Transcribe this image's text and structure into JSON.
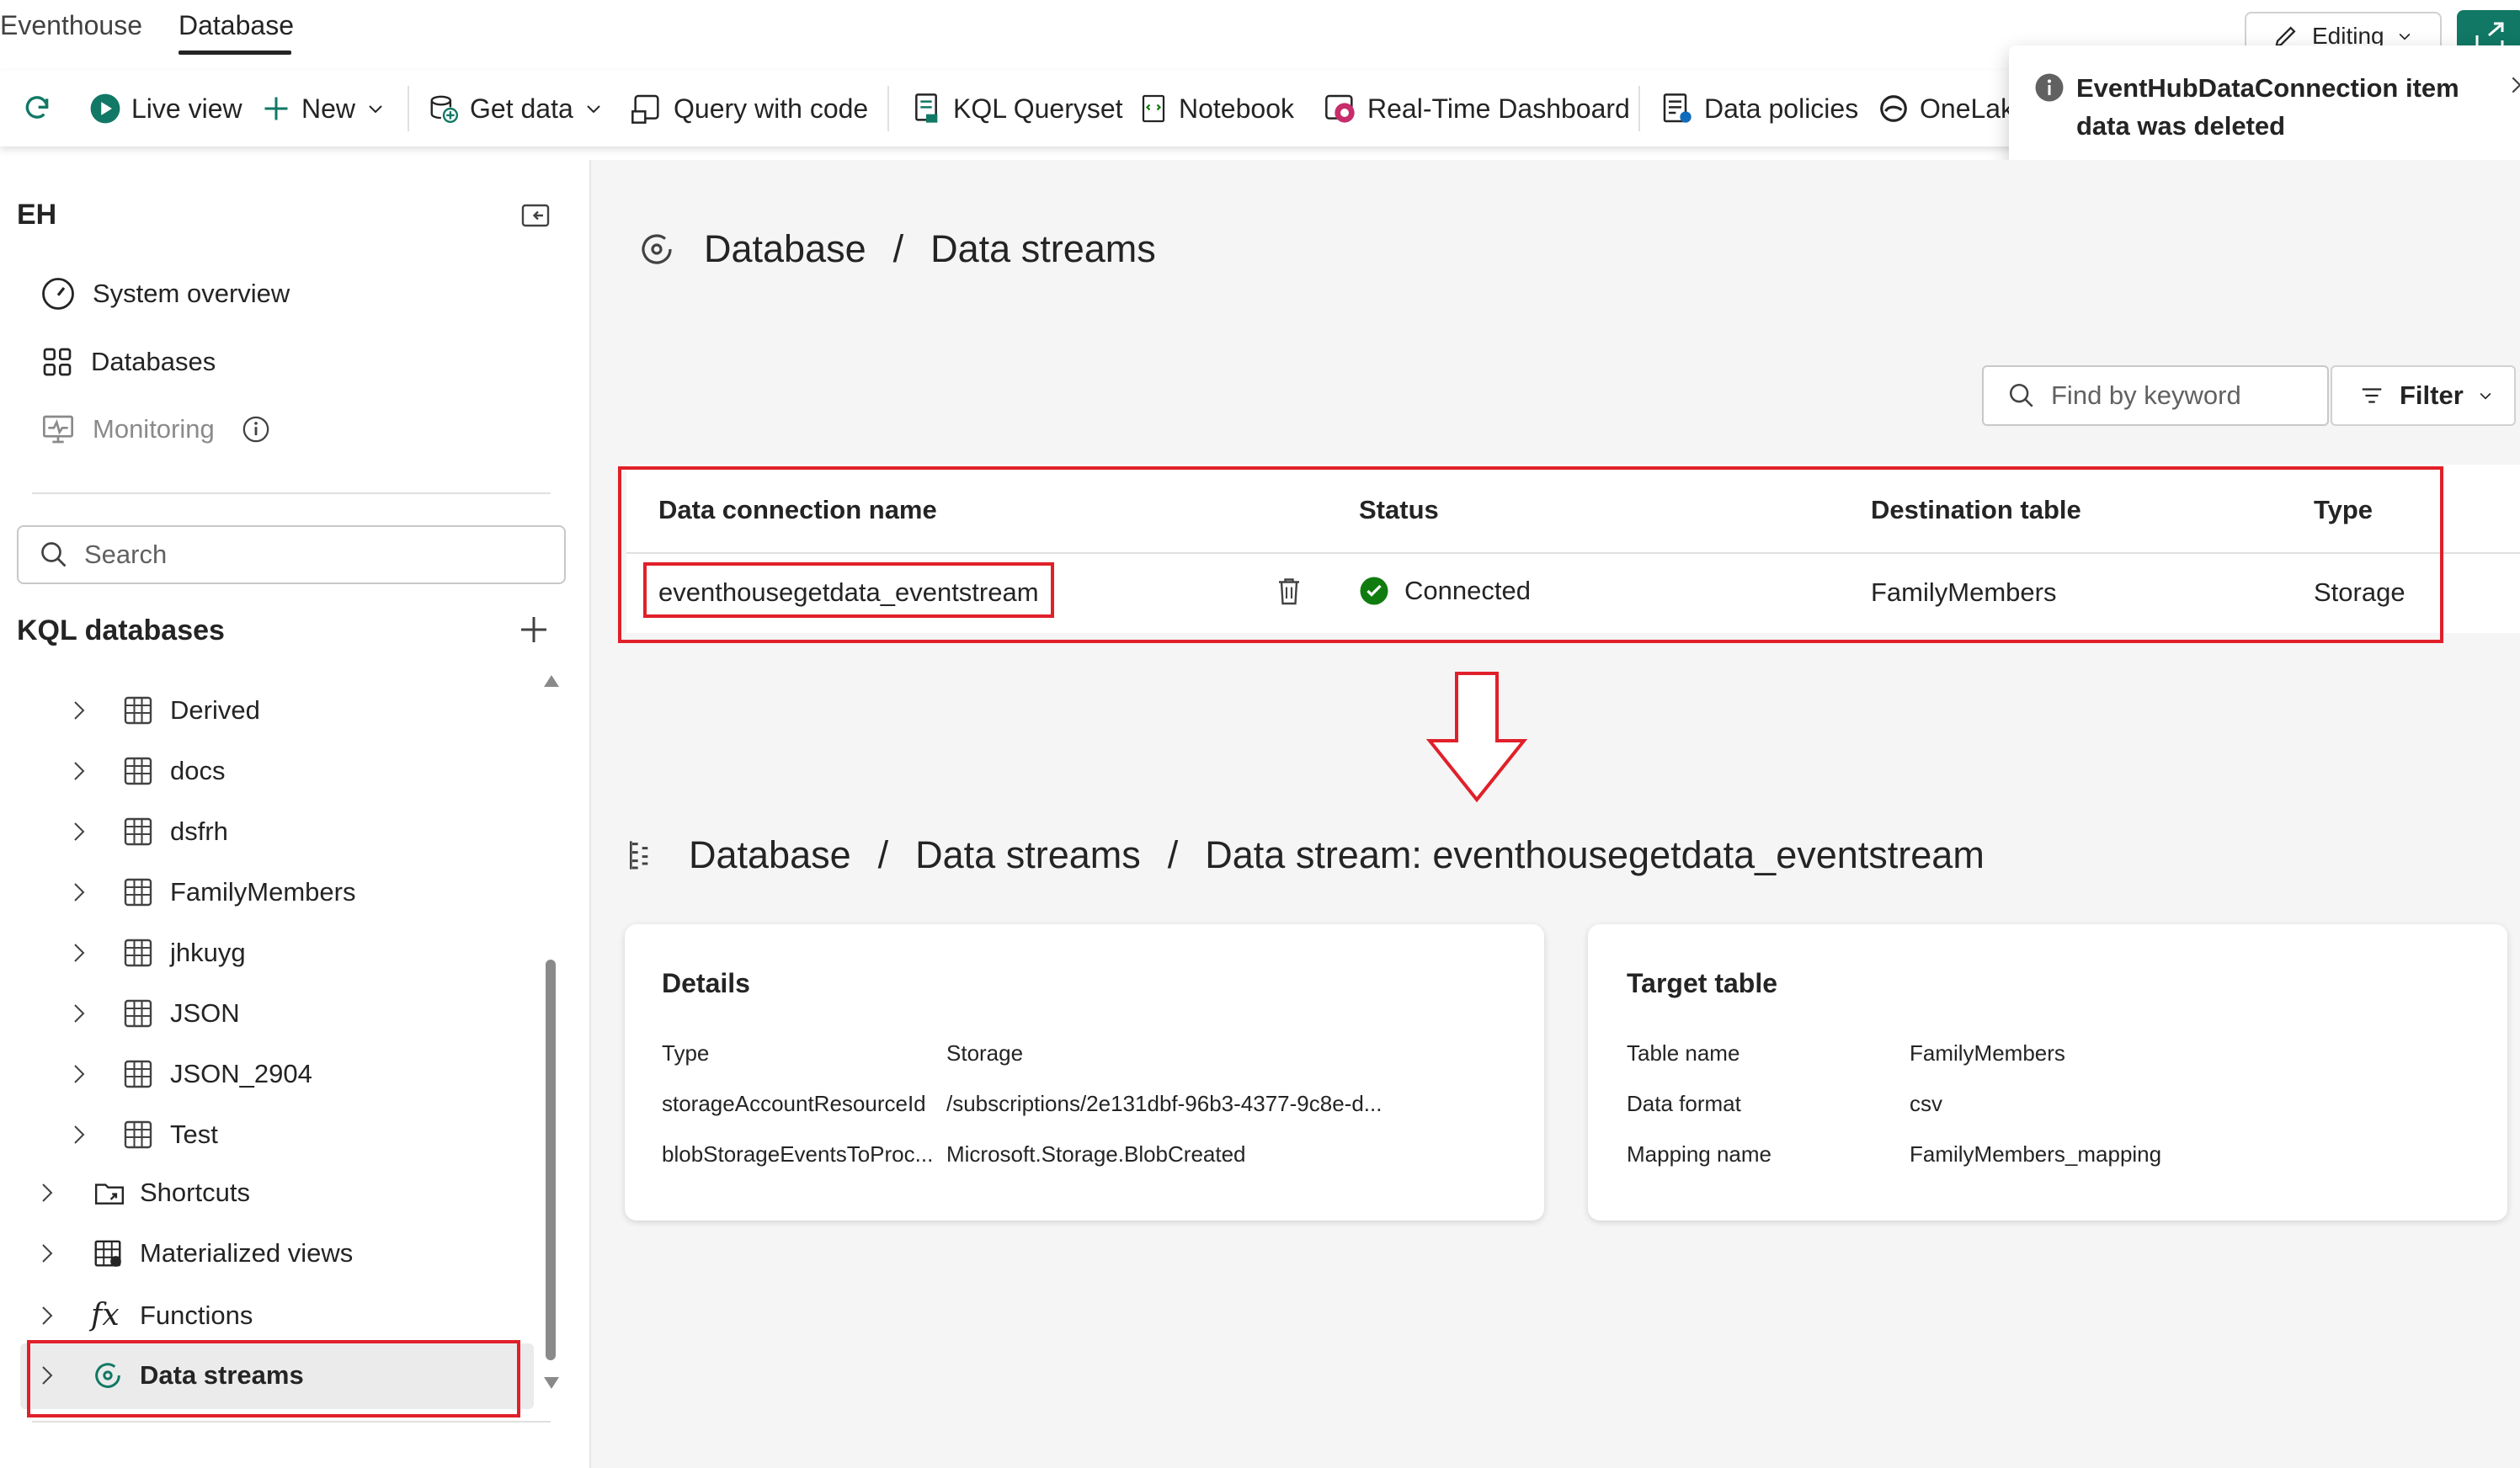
{
  "tabs": [
    "Eventhouse",
    "Database"
  ],
  "editing_label": "Editing",
  "toolbar": {
    "live_view": "Live view",
    "new": "New",
    "get_data": "Get data",
    "query_with_code": "Query with code",
    "kql_queryset": "KQL Queryset",
    "notebook": "Notebook",
    "realtime_dashboard": "Real-Time Dashboard",
    "data_policies": "Data policies",
    "onelake": "OneLak"
  },
  "toast": {
    "message": "EventHubDataConnection item data was deleted"
  },
  "sidebar": {
    "title": "EH",
    "nav": [
      "System overview",
      "Databases",
      "Monitoring"
    ],
    "search_placeholder": "Search",
    "kql_header": "KQL databases",
    "tables": [
      "Derived",
      "docs",
      "dsfrh",
      "FamilyMembers",
      "jhkuyg",
      "JSON",
      "JSON_2904",
      "Test"
    ],
    "groups": [
      "Shortcuts",
      "Materialized views",
      "Functions",
      "Data streams"
    ]
  },
  "breadcrumb1": {
    "a": "Database",
    "sep": "/",
    "b": "Data streams"
  },
  "find_placeholder": "Find by keyword",
  "filter_label": "Filter",
  "table": {
    "headers": [
      "Data connection name",
      "Status",
      "Destination table",
      "Type"
    ],
    "row": {
      "name": "eventhousegetdata_eventstream",
      "status": "Connected",
      "destination": "FamilyMembers",
      "type": "Storage"
    }
  },
  "breadcrumb2": {
    "a": "Database",
    "sep": "/",
    "b": "Data streams",
    "c": "Data stream: eventhousegetdata_eventstream"
  },
  "details": {
    "title": "Details",
    "rows": [
      {
        "k": "Type",
        "v": "Storage"
      },
      {
        "k": "storageAccountResourceId",
        "v": "/subscriptions/2e131dbf-96b3-4377-9c8e-d..."
      },
      {
        "k": "blobStorageEventsToProc...",
        "v": "Microsoft.Storage.BlobCreated"
      }
    ]
  },
  "target": {
    "title": "Target table",
    "rows": [
      {
        "k": "Table name",
        "v": "FamilyMembers"
      },
      {
        "k": "Data format",
        "v": "csv"
      },
      {
        "k": "Mapping name",
        "v": "FamilyMembers_mapping"
      }
    ]
  },
  "colors": {
    "accent_green": "#117865",
    "highlight_red": "#e0202a",
    "status_green": "#107c10"
  }
}
